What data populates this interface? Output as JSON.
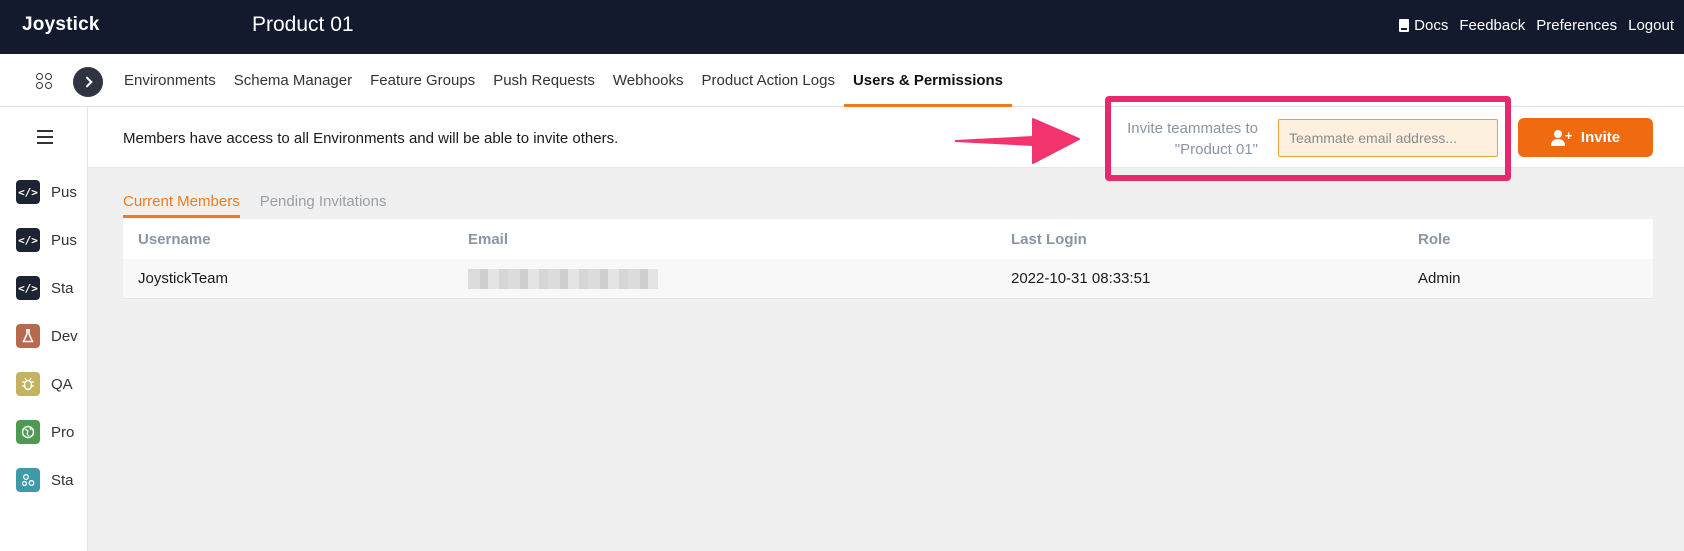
{
  "app": {
    "logo": "Joystick",
    "product_title": "Product 01"
  },
  "top_links": {
    "docs": "Docs",
    "feedback": "Feedback",
    "preferences": "Preferences",
    "logout": "Logout"
  },
  "tabs": [
    {
      "label": "Environments",
      "active": false
    },
    {
      "label": "Schema Manager",
      "active": false
    },
    {
      "label": "Feature Groups",
      "active": false
    },
    {
      "label": "Push Requests",
      "active": false
    },
    {
      "label": "Webhooks",
      "active": false
    },
    {
      "label": "Product Action Logs",
      "active": false
    },
    {
      "label": "Users & Permissions",
      "active": true
    }
  ],
  "sidebar": {
    "items": [
      {
        "label": "Pus",
        "icon": "code-icon",
        "color": "#1c2333"
      },
      {
        "label": "Pus",
        "icon": "code-icon",
        "color": "#1c2333"
      },
      {
        "label": "Sta",
        "icon": "code-icon",
        "color": "#1c2333"
      },
      {
        "label": "Dev",
        "icon": "flask-icon",
        "color": "#b5694f"
      },
      {
        "label": "QA",
        "icon": "bug-icon",
        "color": "#c4b261"
      },
      {
        "label": "Pro",
        "icon": "globe-icon",
        "color": "#4e9a52"
      },
      {
        "label": "Sta",
        "icon": "nodes-icon",
        "color": "#3d9aa8"
      }
    ]
  },
  "info": {
    "text": "Members have access to all Environments and will be able to invite others.",
    "invite_label_line1": "Invite teammates to",
    "invite_label_line2": "\"Product 01\"",
    "email_placeholder": "Teammate email address...",
    "invite_button": "Invite"
  },
  "member_tabs": [
    {
      "label": "Current Members",
      "active": true
    },
    {
      "label": "Pending Invitations",
      "active": false
    }
  ],
  "table": {
    "headers": [
      "Username",
      "Email",
      "Last Login",
      "Role"
    ],
    "rows": [
      {
        "username": "JoystickTeam",
        "email": "",
        "last_login": "2022-10-31 08:33:51",
        "role": "Admin"
      }
    ]
  },
  "colors": {
    "accent": "#f27a1a",
    "highlight": "#e8286c",
    "topbar": "#141a2e"
  }
}
